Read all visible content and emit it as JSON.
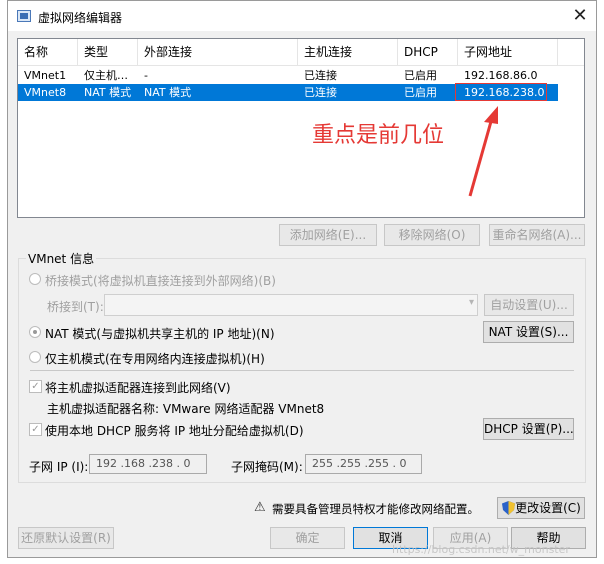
{
  "window": {
    "title": "虚拟网络编辑器",
    "close_glyph": "✕"
  },
  "table": {
    "columns": [
      "名称",
      "类型",
      "外部连接",
      "主机连接",
      "DHCP",
      "子网地址"
    ],
    "rows": [
      {
        "name": "VMnet1",
        "type": "仅主机…",
        "external": "-",
        "host": "已连接",
        "dhcp": "已启用",
        "subnet": "192.168.86.0",
        "selected": false
      },
      {
        "name": "VMnet8",
        "type": "NAT 模式",
        "external": "NAT 模式",
        "host": "已连接",
        "dhcp": "已启用",
        "subnet": "192.168.238.0",
        "selected": true
      }
    ]
  },
  "annotation": {
    "text": "重点是前几位",
    "color": "#e53935"
  },
  "list_buttons": {
    "add": "添加网络(E)...",
    "remove": "移除网络(O)",
    "rename": "重命名网络(A)..."
  },
  "vmnet_info": {
    "title": "VMnet 信息",
    "bridged_label": "桥接模式(将虚拟机直接连接到外部网络)(B)",
    "bridge_to_label": "桥接到(T):",
    "auto_settings": "自动设置(U)...",
    "nat_label": "NAT 模式(与虚拟机共享主机的 IP 地址)(N)",
    "nat_settings": "NAT 设置(S)...",
    "hostonly_label": "仅主机模式(在专用网络内连接虚拟机)(H)",
    "connect_adapter_label": "将主机虚拟适配器连接到此网络(V)",
    "adapter_name_label": "主机虚拟适配器名称: VMware 网络适配器 VMnet8",
    "dhcp_label": "使用本地 DHCP 服务将 IP 地址分配给虚拟机(D)",
    "dhcp_settings": "DHCP 设置(P)...",
    "subnet_ip_label": "子网 IP (I):",
    "subnet_ip_value": "192 .168 .238 . 0",
    "subnet_mask_label": "子网掩码(M):",
    "subnet_mask_value": "255 .255 .255 . 0",
    "selected_mode": "nat",
    "connect_adapter_checked": true,
    "dhcp_checked": true
  },
  "footer": {
    "admin_notice": "需要具备管理员特权才能修改网络配置。",
    "change_settings": "更改设置(C)",
    "restore_defaults": "还原默认设置(R)",
    "ok": "确定",
    "cancel": "取消",
    "apply": "应用(A)",
    "help": "帮助",
    "watermark": "https://blog.csdn.net/w_monster"
  },
  "colors": {
    "selection": "#0078d7",
    "accent_red": "#e53935"
  }
}
